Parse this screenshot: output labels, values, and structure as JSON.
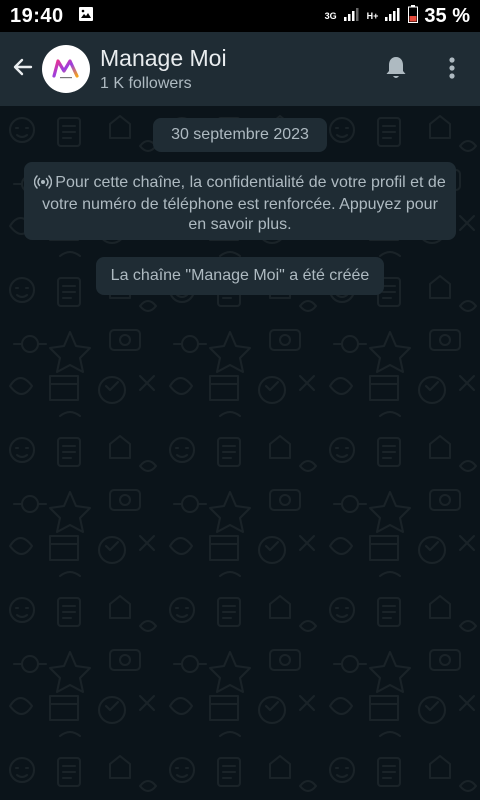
{
  "status_bar": {
    "time": "19:40",
    "network_type": "3G",
    "network_type2": "H+",
    "battery_percent": "35 %"
  },
  "header": {
    "channel_name": "Manage Moi",
    "followers": "1 K followers"
  },
  "chat": {
    "date_label": "30 septembre 2023",
    "privacy_notice": "Pour cette chaîne, la confidentialité de votre profil et de votre numéro de téléphone est renforcée. Appuyez pour en savoir plus.",
    "created_notice": "La chaîne \"Manage Moi\" a été créée"
  },
  "icons": {
    "back": "arrow-left-icon",
    "bell": "bell-icon",
    "menu": "more-vertical-icon",
    "broadcast": "broadcast-icon"
  },
  "colors": {
    "app_bar": "#1f2c34",
    "chat_background": "#0b141a",
    "bubble": "#1f2c34",
    "secondary_text": "#aebac1",
    "primary_text": "#e9edef"
  }
}
